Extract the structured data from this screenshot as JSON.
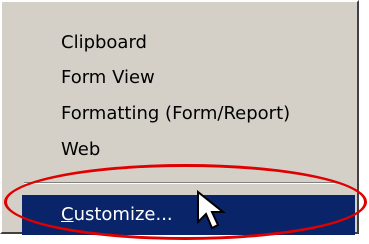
{
  "menu": {
    "items": [
      {
        "label": "Clipboard"
      },
      {
        "label": "Form View"
      },
      {
        "label": "Formatting (Form/Report)"
      },
      {
        "label": "Web"
      }
    ],
    "customize": {
      "mnemonic": "C",
      "rest": "ustomize..."
    }
  },
  "colors": {
    "menu_background": "#d4d0c8",
    "highlight_background": "#0a246a",
    "highlight_text": "#ffffff",
    "annotation_ellipse": "#e00000"
  },
  "icons": {
    "cursor": "arrow-cursor-icon"
  }
}
